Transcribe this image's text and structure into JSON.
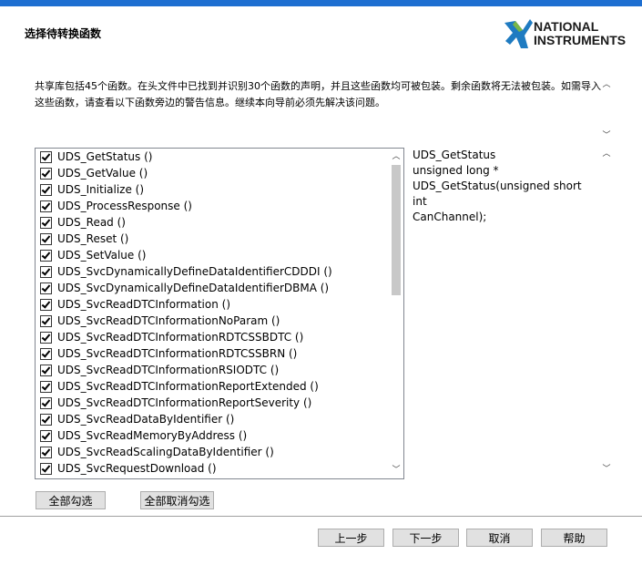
{
  "wizard": {
    "title": "选择待转换函数",
    "logo_line1": "NATIONAL",
    "logo_line2": "INSTRUMENTS",
    "description": "共享库包括45个函数。在头文件中已找到并识别30个函数的声明，并且这些函数均可被包装。剩余函数将无法被包装。如需导入这些函数，请查看以下函数旁边的警告信息。继续本向导前必须先解决该问题。"
  },
  "functions": [
    {
      "label": "UDS_GetStatus ()",
      "checked": true
    },
    {
      "label": "UDS_GetValue ()",
      "checked": true
    },
    {
      "label": "UDS_Initialize ()",
      "checked": true
    },
    {
      "label": "UDS_ProcessResponse ()",
      "checked": true
    },
    {
      "label": "UDS_Read ()",
      "checked": true
    },
    {
      "label": "UDS_Reset ()",
      "checked": true
    },
    {
      "label": "UDS_SetValue ()",
      "checked": true
    },
    {
      "label": "UDS_SvcDynamicallyDefineDataIdentifierCDDDI ()",
      "checked": true
    },
    {
      "label": "UDS_SvcDynamicallyDefineDataIdentifierDBMA ()",
      "checked": true
    },
    {
      "label": "UDS_SvcReadDTCInformation ()",
      "checked": true
    },
    {
      "label": "UDS_SvcReadDTCInformationNoParam ()",
      "checked": true
    },
    {
      "label": "UDS_SvcReadDTCInformationRDTCSSBDTC ()",
      "checked": true
    },
    {
      "label": "UDS_SvcReadDTCInformationRDTCSSBRN ()",
      "checked": true
    },
    {
      "label": "UDS_SvcReadDTCInformationRSIODTC ()",
      "checked": true
    },
    {
      "label": "UDS_SvcReadDTCInformationReportExtended ()",
      "checked": true
    },
    {
      "label": "UDS_SvcReadDTCInformationReportSeverity ()",
      "checked": true
    },
    {
      "label": "UDS_SvcReadDataByIdentifier ()",
      "checked": true
    },
    {
      "label": "UDS_SvcReadMemoryByAddress ()",
      "checked": true
    },
    {
      "label": "UDS_SvcReadScalingDataByIdentifier ()",
      "checked": true
    },
    {
      "label": "UDS_SvcRequestDownload ()",
      "checked": true
    }
  ],
  "detail": {
    "text": "UDS_GetStatus\nunsigned long *\nUDS_GetStatus(unsigned short int\nCanChannel);"
  },
  "buttons": {
    "select_all": "全部勾选",
    "deselect_all": "全部取消勾选",
    "back": "上一步",
    "next": "下一步",
    "cancel": "取消",
    "help": "帮助"
  },
  "icons": {
    "scroll_up": "scroll-up-arrow-icon",
    "scroll_down": "scroll-down-arrow-icon",
    "logo": "ni-eagle-logo"
  },
  "colors": {
    "accent": "#1e6fd1",
    "logo_blue": "#1f7bc1",
    "logo_green": "#7ab648"
  }
}
